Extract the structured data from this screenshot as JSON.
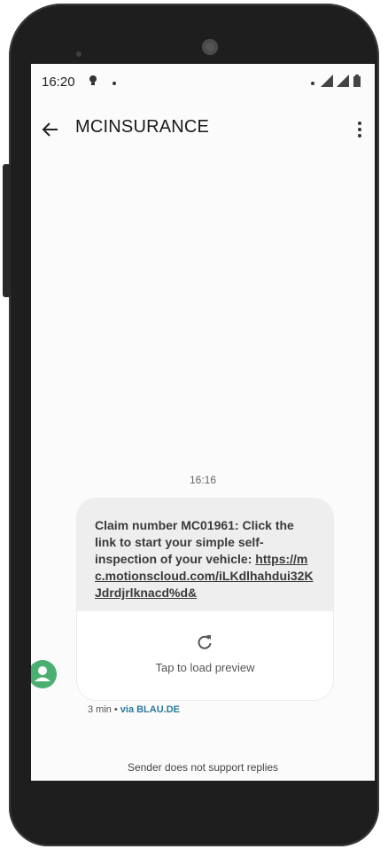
{
  "status_bar": {
    "time": "16:20"
  },
  "app_bar": {
    "title": "MCINSURANCE"
  },
  "conversation": {
    "timestamp": "16:16",
    "message": {
      "text": "Claim number MC01961: Click the link to start your simple self-inspection of your vehicle:",
      "link": "https://mc.motionscloud.com/iLKdlhahdui32KJdrdjrlknacd%d&"
    },
    "preview": {
      "label": "Tap to load preview"
    },
    "meta": {
      "age": "3 min",
      "separator": "•",
      "via": "via BLAU.DE"
    },
    "footer_note": "Sender does not support replies"
  },
  "colors": {
    "avatar": "#4caf72",
    "via_link": "#2a7a9b",
    "bubble_background": "#eeeeee"
  }
}
